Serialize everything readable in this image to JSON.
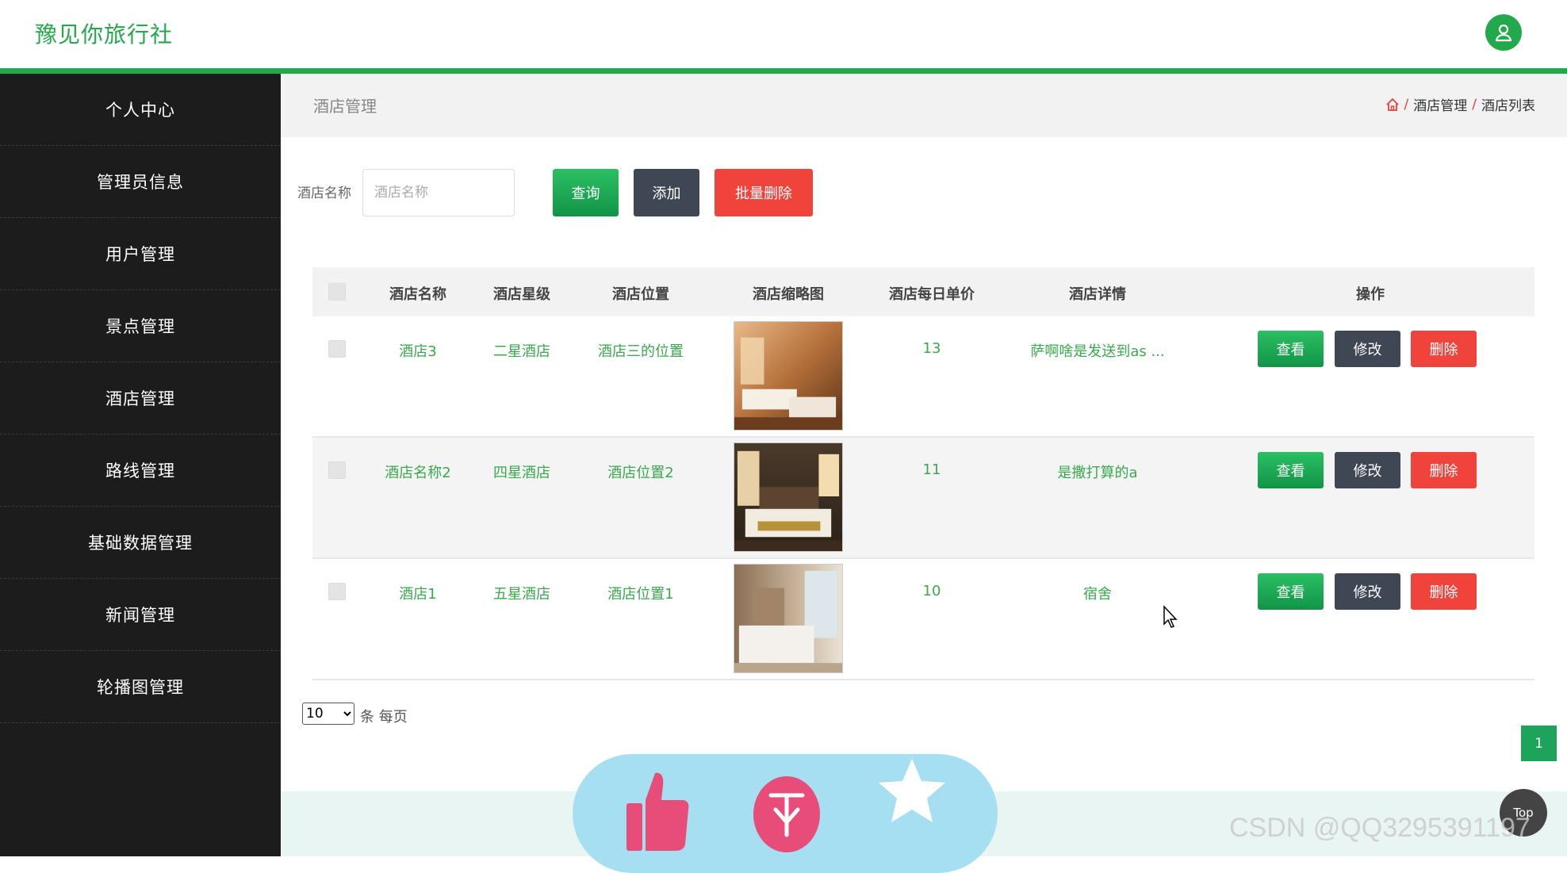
{
  "brand": {
    "title": "豫见你旅行社",
    "accent": "#22a94b"
  },
  "sidebar": {
    "items": [
      {
        "label": "个人中心"
      },
      {
        "label": "管理员信息"
      },
      {
        "label": "用户管理"
      },
      {
        "label": "景点管理"
      },
      {
        "label": "酒店管理"
      },
      {
        "label": "路线管理"
      },
      {
        "label": "基础数据管理"
      },
      {
        "label": "新闻管理"
      },
      {
        "label": "轮播图管理"
      }
    ]
  },
  "header": {
    "title": "酒店管理",
    "breadcrumb": [
      "酒店管理",
      "酒店列表"
    ],
    "breadcrumb_sep": "/"
  },
  "search": {
    "label": "酒店名称",
    "placeholder": "酒店名称",
    "query_label": "查询",
    "add_label": "添加",
    "batch_delete_label": "批量删除"
  },
  "table": {
    "columns": [
      "酒店名称",
      "酒店星级",
      "酒店位置",
      "酒店缩略图",
      "酒店每日单价",
      "酒店详情",
      "操作"
    ],
    "rows": [
      {
        "name": "酒店3",
        "star": "二星酒店",
        "location": "酒店三的位置",
        "price": "13",
        "detail": "萨啊啥是发送到as ...",
        "thumb": "hotel-room-photo"
      },
      {
        "name": "酒店名称2",
        "star": "四星酒店",
        "location": "酒店位置2",
        "price": "11",
        "detail": "是撒打算的a",
        "thumb": "hotel-room-photo"
      },
      {
        "name": "酒店1",
        "star": "五星酒店",
        "location": "酒店位置1",
        "price": "10",
        "detail": "宿舍",
        "thumb": "hotel-room-photo"
      }
    ],
    "actions": {
      "view": "查看",
      "edit": "修改",
      "delete": "删除"
    }
  },
  "pagination": {
    "page_size": "10",
    "page_size_options": [
      "10"
    ],
    "per_page_label": "条 每页",
    "current_page": "1"
  },
  "float": {
    "top_label": "Top"
  },
  "watermark": "CSDN @QQ3295391197"
}
